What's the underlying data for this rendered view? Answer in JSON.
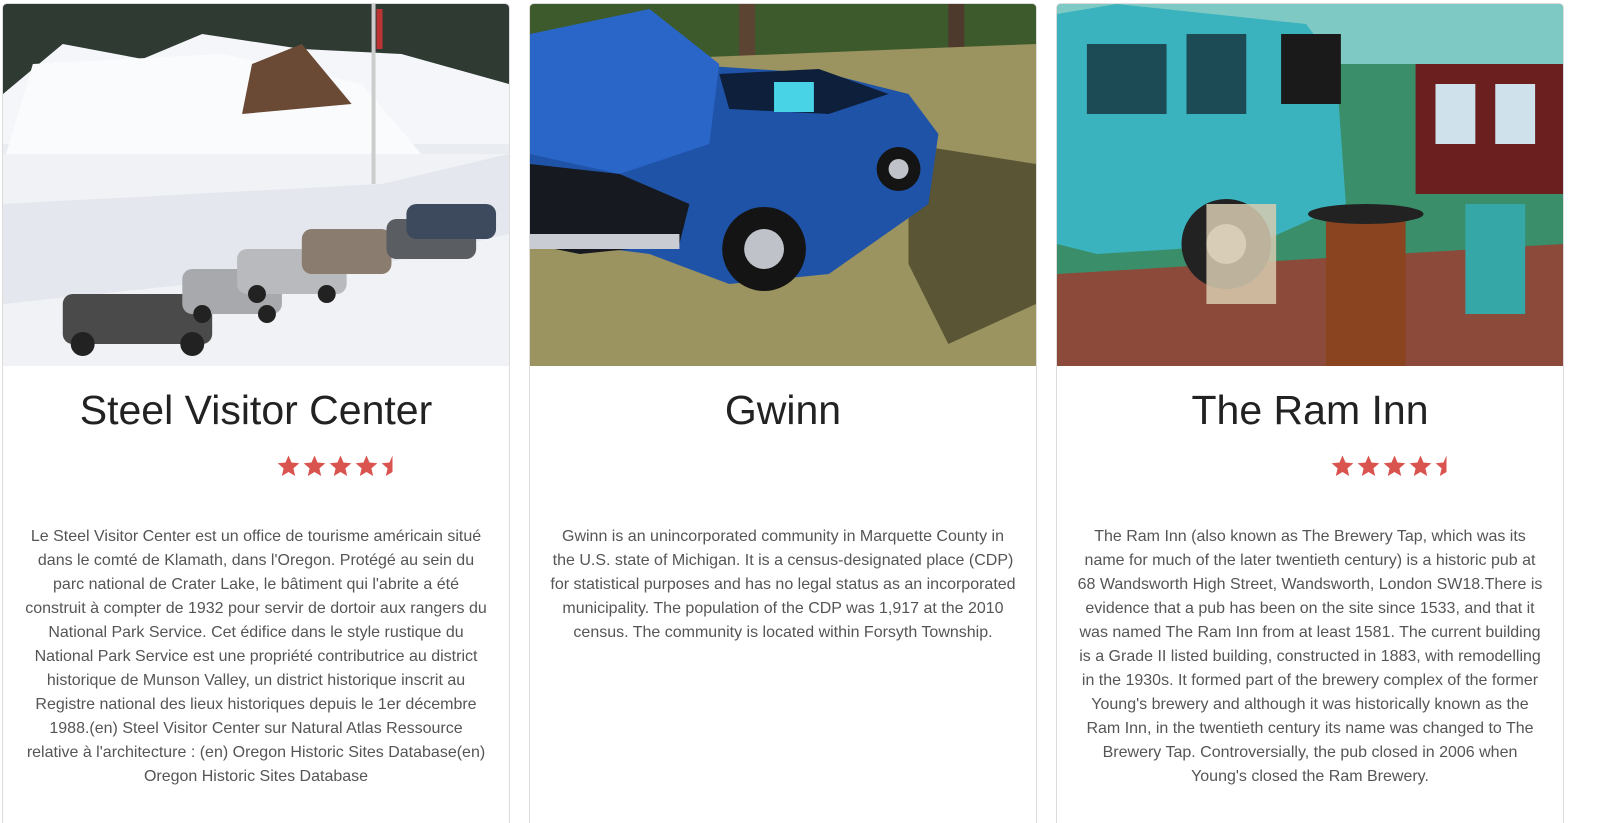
{
  "cards": [
    {
      "title": "Steel Visitor Center",
      "image": "snowy-lodge-parking-lot-photo",
      "rating": 4.5,
      "description": "Le Steel Visitor Center est un office de tourisme américain situé dans le comté de Klamath, dans l'Oregon. Protégé au sein du parc national de Crater Lake, le bâtiment qui l'abrite a été construit à compter de 1932 pour servir de dortoir aux rangers du National Park Service. Cet édifice dans le style rustique du National Park Service est une propriété contributrice au district historique de Munson Valley, un district historique inscrit au Registre national des lieux historiques depuis le 1er décembre 1988.(en) Steel Visitor Center sur Natural Atlas Ressource relative à l'architecture : (en) Oregon Historic Sites Database(en) Oregon Historic Sites Database"
    },
    {
      "title": "Gwinn",
      "image": "blue-classic-car-photo",
      "rating": null,
      "description": "Gwinn is an unincorporated community in Marquette County in the U.S. state of Michigan. It is a census-designated place (CDP) for statistical purposes and has no legal status as an incorporated municipality. The population of the CDP was 1,917 at the 2010 census. The community is located within Forsyth Township."
    },
    {
      "title": "The Ram Inn",
      "image": "teal-van-pub-interior-photo",
      "rating": 4.5,
      "description": "The Ram Inn (also known as The Brewery Tap, which was its name for much of the later twentieth century) is a historic pub at 68 Wandsworth High Street, Wandsworth, London SW18.There is evidence that a pub has been on the site since 1533, and that it was named The Ram Inn from at least 1581. The current building is a Grade II listed building, constructed in 1883, with remodelling in the 1930s. It formed part of the brewery complex of the former Young's brewery and although it was historically known as the Ram Inn, in the twentieth century its name was changed to The Brewery Tap. Controversially, the pub closed in 2006 when Young's closed the Ram Brewery."
    }
  ],
  "colors": {
    "star": "#d9534f",
    "title": "#222222",
    "text": "#555555",
    "border": "#dcdcdc"
  }
}
